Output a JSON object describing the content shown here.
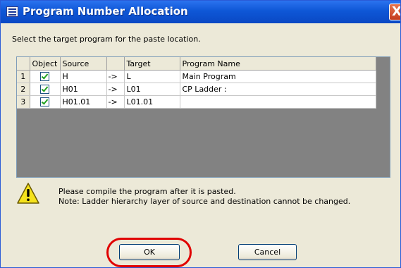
{
  "window": {
    "title": "Program Number Allocation",
    "close_label": "X"
  },
  "instruction": "Select the target program for the paste location.",
  "table": {
    "columns": [
      "Object",
      "Source",
      "Target",
      "Program Name"
    ],
    "rows": [
      {
        "num": "1",
        "checked": true,
        "source": "H",
        "arrow": "->",
        "target": "L",
        "name": "Main Program"
      },
      {
        "num": "2",
        "checked": true,
        "source": "H01",
        "arrow": "->",
        "target": "L01",
        "name": "CP Ladder :"
      },
      {
        "num": "3",
        "checked": true,
        "source": "H01.01",
        "arrow": "->",
        "target": "L01.01",
        "name": ""
      }
    ]
  },
  "message": {
    "icon": "warning-icon",
    "line1": "Please compile the program after it is pasted.",
    "line2": "Note: Ladder hierarchy layer of source and destination cannot be changed."
  },
  "buttons": {
    "ok": "OK",
    "cancel": "Cancel"
  },
  "colors": {
    "titlebar": "#0e57d6",
    "grid_empty": "#828282",
    "highlight": "#e00000"
  }
}
